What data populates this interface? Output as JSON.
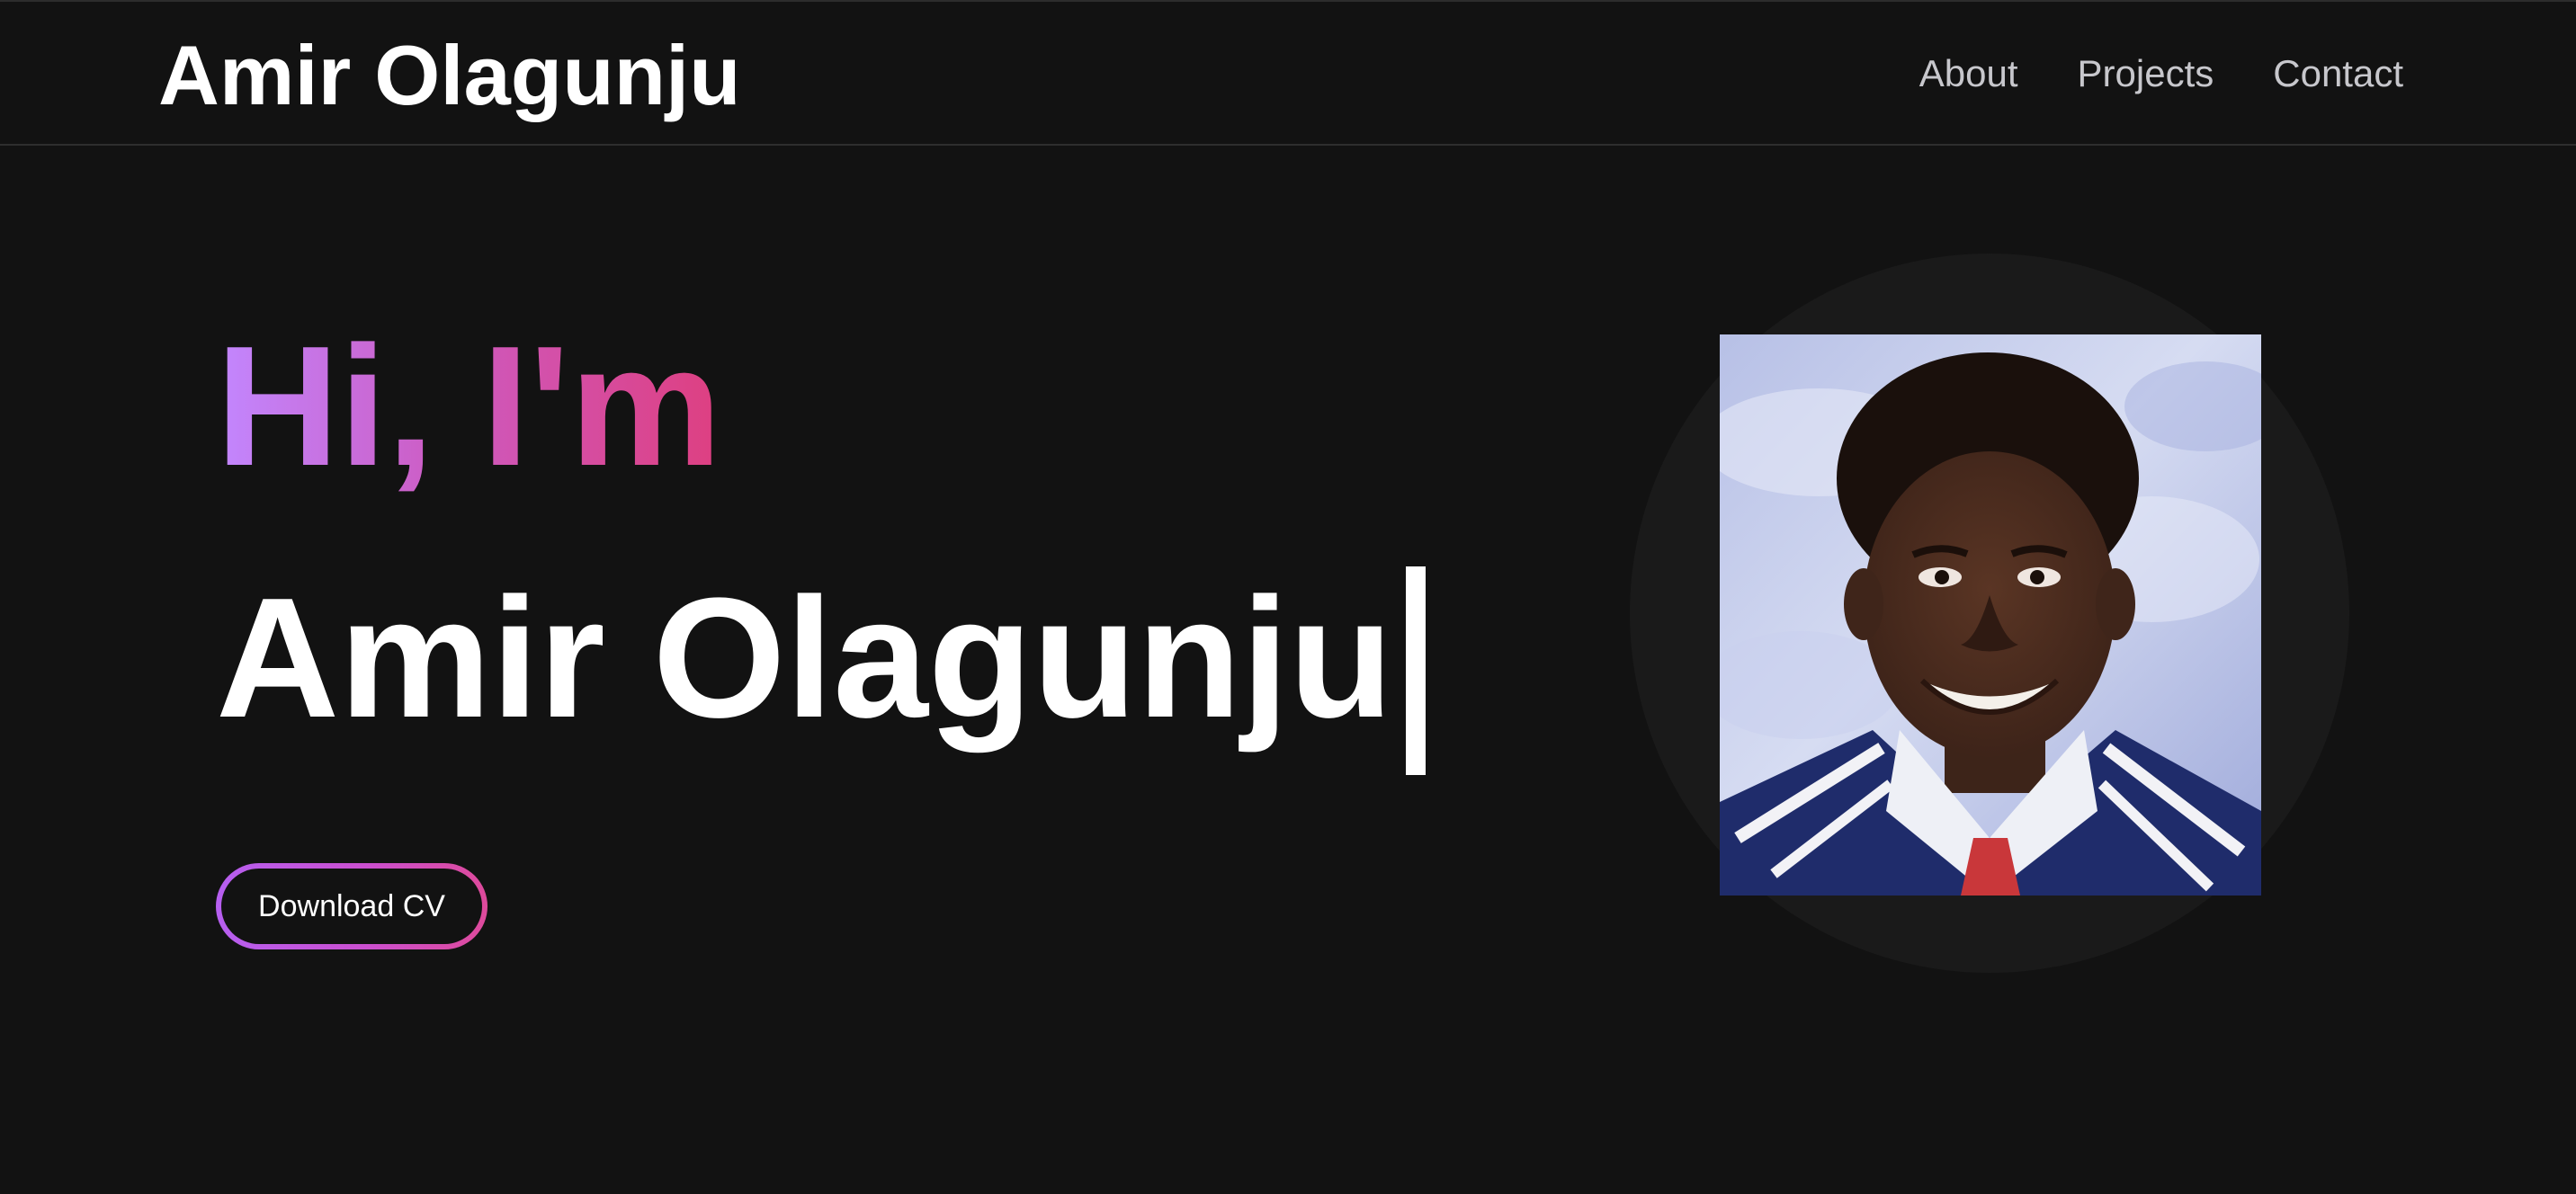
{
  "header": {
    "brand": "Amir Olagunju",
    "nav": [
      "About",
      "Projects",
      "Contact"
    ]
  },
  "hero": {
    "greeting": "Hi, I'm",
    "typed_name": "Amir Olagunju",
    "cv_button": "Download CV"
  },
  "colors": {
    "background": "#121212",
    "accent_gradient_start": "#c287ff",
    "accent_gradient_end": "#de3f80"
  }
}
